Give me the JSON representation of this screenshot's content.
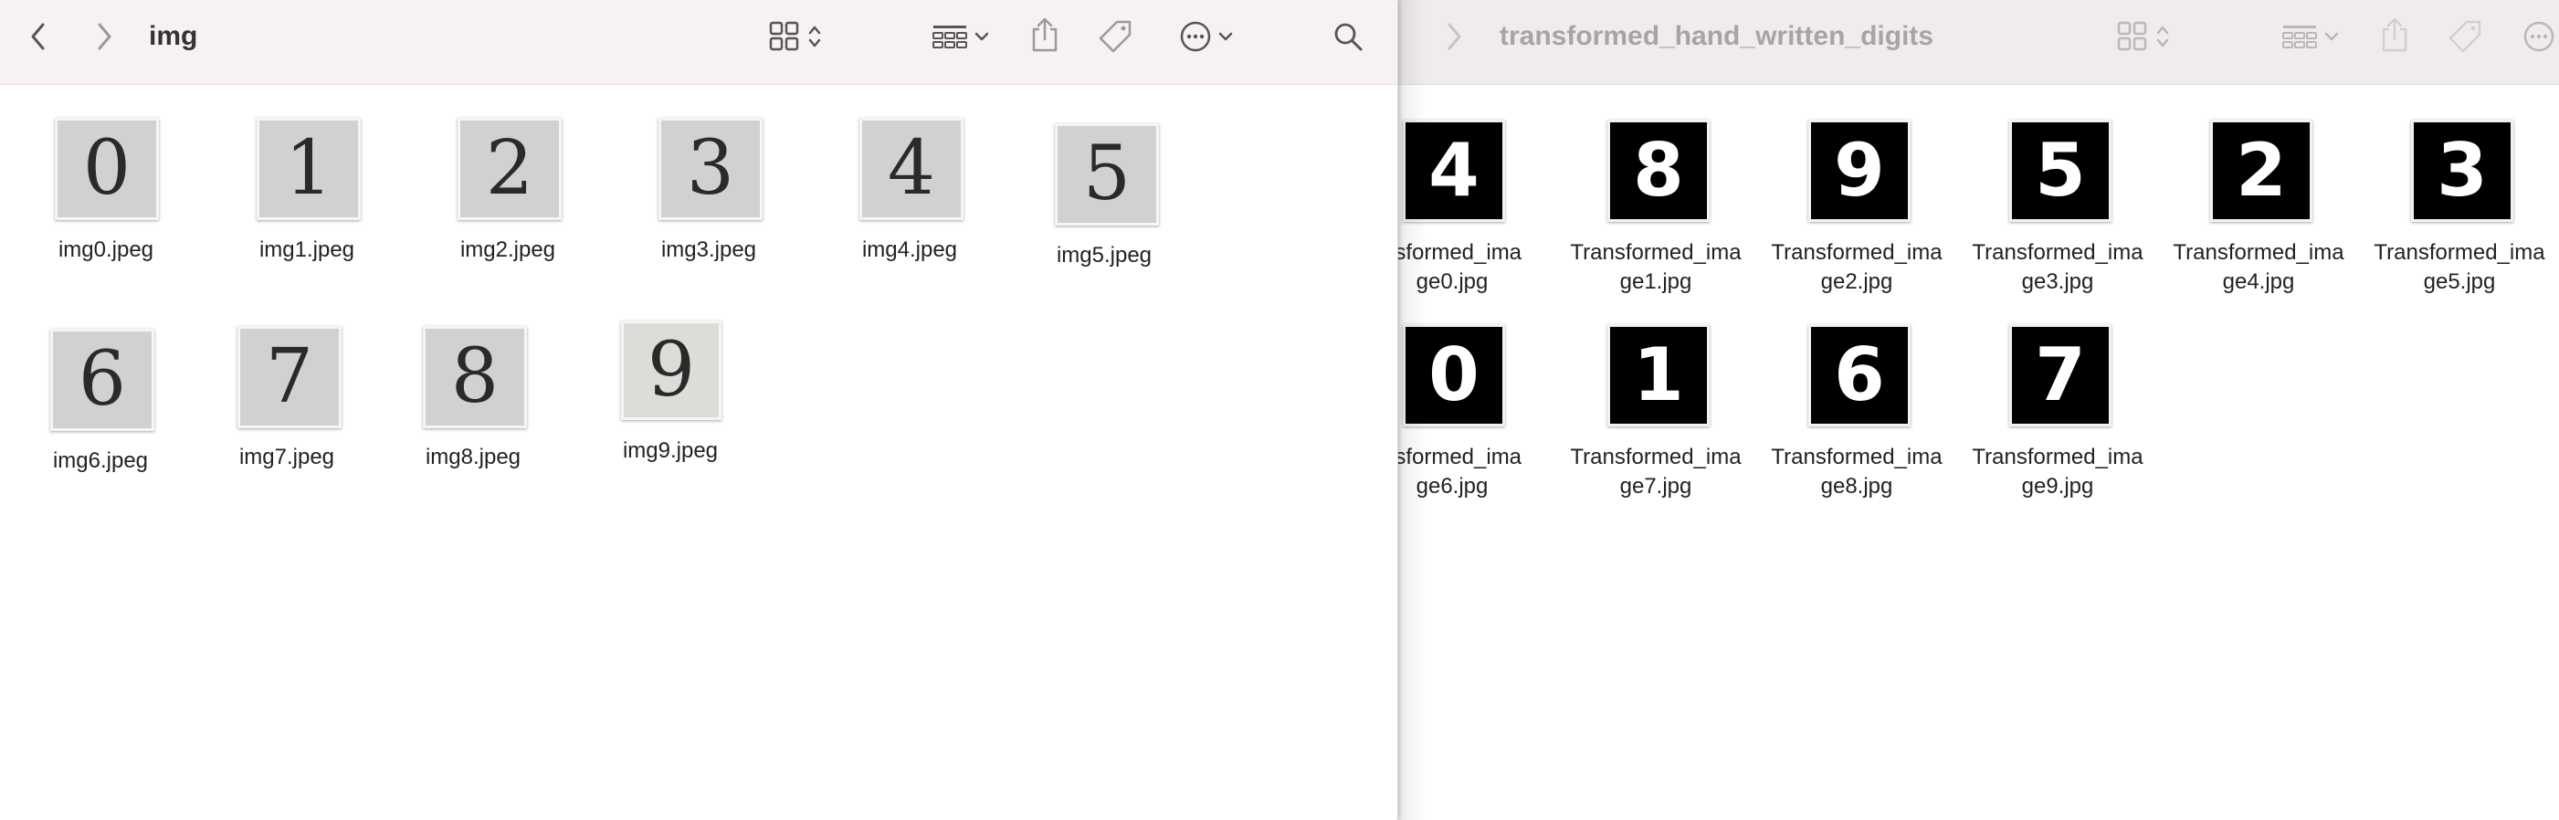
{
  "left_window": {
    "title": "img",
    "toolbar": {
      "back_icon": "chevron-left-icon",
      "forward_icon": "chevron-right-icon",
      "view_icon": "grid-view-icon",
      "group_icon": "group-by-icon",
      "share_icon": "share-icon",
      "tag_icon": "tag-icon",
      "more_icon": "ellipsis-circle-icon",
      "search_icon": "search-icon"
    },
    "files": [
      {
        "name": "img0.jpeg",
        "glyph": "0"
      },
      {
        "name": "img1.jpeg",
        "glyph": "1"
      },
      {
        "name": "img2.jpeg",
        "glyph": "2"
      },
      {
        "name": "img3.jpeg",
        "glyph": "3"
      },
      {
        "name": "img4.jpeg",
        "glyph": "4"
      },
      {
        "name": "img5.jpeg",
        "glyph": "5"
      },
      {
        "name": "img6.jpeg",
        "glyph": "6"
      },
      {
        "name": "img7.jpeg",
        "glyph": "7"
      },
      {
        "name": "img8.jpeg",
        "glyph": "8"
      },
      {
        "name": "img9.jpeg",
        "glyph": "9"
      }
    ]
  },
  "right_window": {
    "title": "transformed_hand_written_digits",
    "files": [
      {
        "line1": "nsformed_ima",
        "line2": "ge0.jpg",
        "glyph": "4"
      },
      {
        "line1": "Transformed_ima",
        "line2": "ge1.jpg",
        "glyph": "8"
      },
      {
        "line1": "Transformed_ima",
        "line2": "ge2.jpg",
        "glyph": "9"
      },
      {
        "line1": "Transformed_ima",
        "line2": "ge3.jpg",
        "glyph": "5"
      },
      {
        "line1": "Transformed_ima",
        "line2": "ge4.jpg",
        "glyph": "2"
      },
      {
        "line1": "Transformed_ima",
        "line2": "ge5.jpg",
        "glyph": "3"
      },
      {
        "line1": "nsformed_ima",
        "line2": "ge6.jpg",
        "glyph": "0"
      },
      {
        "line1": "Transformed_ima",
        "line2": "ge7.jpg",
        "glyph": "1"
      },
      {
        "line1": "Transformed_ima",
        "line2": "ge8.jpg",
        "glyph": "6"
      },
      {
        "line1": "Transformed_ima",
        "line2": "ge9.jpg",
        "glyph": "7"
      }
    ]
  }
}
